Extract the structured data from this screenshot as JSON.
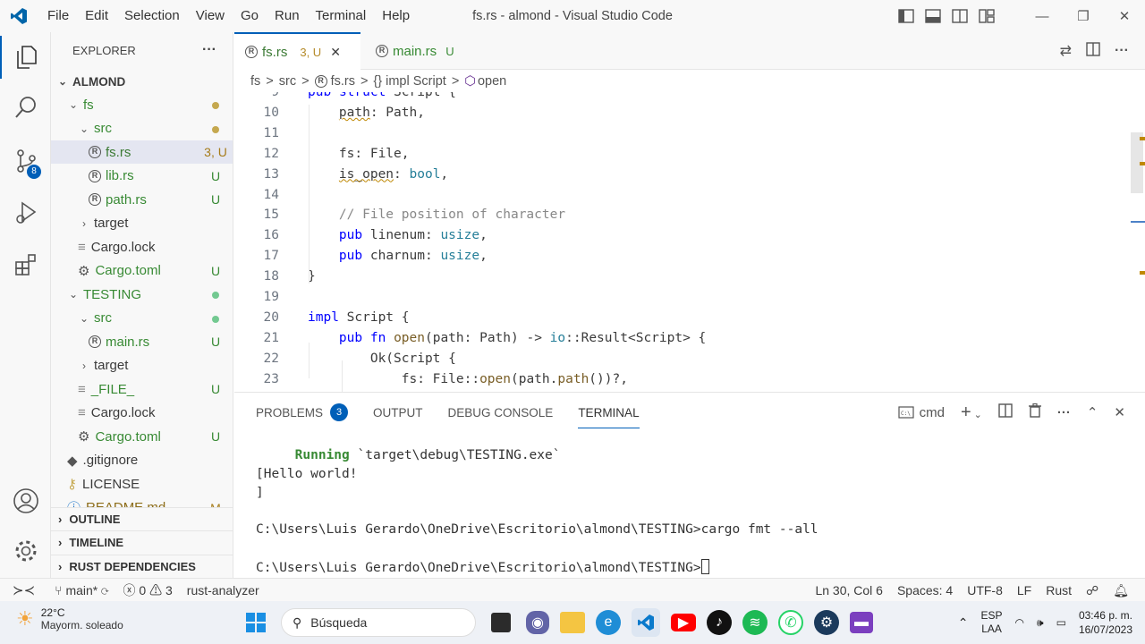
{
  "titlebar": {
    "menus": [
      "File",
      "Edit",
      "Selection",
      "View",
      "Go",
      "Run",
      "Terminal",
      "Help"
    ],
    "title": "fs.rs - almond - Visual Studio Code",
    "controls": {
      "minimize": "—",
      "restore": "❐",
      "close": "✕"
    }
  },
  "activity_bar": {
    "items": [
      "files-icon",
      "search-icon",
      "source-control-icon",
      "run-debug-icon",
      "extensions-icon"
    ],
    "scm_badge": "8",
    "bottom": [
      "account-icon",
      "settings-gear-icon"
    ]
  },
  "explorer": {
    "header": "EXPLORER",
    "more": "···",
    "root": "ALMOND",
    "rows": [
      {
        "label": "fs",
        "status": "",
        "dot": "#c5a84f",
        "kind": "folder",
        "indent": 1,
        "open": true
      },
      {
        "label": "src",
        "status": "",
        "dot": "#c5a84f",
        "kind": "folder",
        "indent": 2,
        "open": true
      },
      {
        "label": "fs.rs",
        "status": "3, U",
        "kind": "rust",
        "indent": 3
      },
      {
        "label": "lib.rs",
        "status": "U",
        "kind": "rust",
        "indent": 3
      },
      {
        "label": "path.rs",
        "status": "U",
        "kind": "rust",
        "indent": 3
      },
      {
        "label": "target",
        "status": "",
        "kind": "folder",
        "indent": 2,
        "open": false
      },
      {
        "label": "Cargo.lock",
        "status": "",
        "kind": "file",
        "indent": 2
      },
      {
        "label": "Cargo.toml",
        "status": "U",
        "kind": "gear",
        "indent": 2
      },
      {
        "label": "TESTING",
        "status": "",
        "dot": "#73c991",
        "kind": "folder",
        "indent": 1,
        "open": true
      },
      {
        "label": "src",
        "status": "",
        "dot": "#73c991",
        "kind": "folder",
        "indent": 2,
        "open": true
      },
      {
        "label": "main.rs",
        "status": "U",
        "kind": "rust",
        "indent": 3
      },
      {
        "label": "target",
        "status": "",
        "kind": "folder",
        "indent": 2,
        "open": false
      },
      {
        "label": "_FILE_",
        "status": "U",
        "kind": "file",
        "indent": 2
      },
      {
        "label": "Cargo.lock",
        "status": "",
        "kind": "file",
        "indent": 2
      },
      {
        "label": "Cargo.toml",
        "status": "U",
        "kind": "gear",
        "indent": 2
      },
      {
        "label": ".gitignore",
        "status": "",
        "kind": "git",
        "indent": 1
      },
      {
        "label": "LICENSE",
        "status": "",
        "kind": "license",
        "indent": 1
      },
      {
        "label": "README.md",
        "status": "M",
        "kind": "info",
        "indent": 1
      }
    ],
    "sections": [
      "OUTLINE",
      "TIMELINE",
      "RUST DEPENDENCIES"
    ]
  },
  "tabs": [
    {
      "label": "fs.rs",
      "status": "3, U",
      "close": "✕"
    },
    {
      "label": "main.rs",
      "status": "U"
    }
  ],
  "breadcrumb": [
    "fs",
    ">",
    "src",
    ">",
    "fs.rs",
    ">",
    "{} impl Script",
    ">",
    "open"
  ],
  "editor": {
    "lines": [
      {
        "n": "9",
        "t": "pub struct Script {"
      },
      {
        "n": "10",
        "t": "    path: Path,"
      },
      {
        "n": "11",
        "t": ""
      },
      {
        "n": "12",
        "t": "    fs: File,"
      },
      {
        "n": "13",
        "t": "    is_open: bool,"
      },
      {
        "n": "14",
        "t": ""
      },
      {
        "n": "15",
        "t": "    // File position of character"
      },
      {
        "n": "16",
        "t": "    pub linenum: usize,"
      },
      {
        "n": "17",
        "t": "    pub charnum: usize,"
      },
      {
        "n": "18",
        "t": "}"
      },
      {
        "n": "19",
        "t": ""
      },
      {
        "n": "20",
        "t": "impl Script {"
      },
      {
        "n": "21",
        "t": "    pub fn open(path: Path) -> io::Result<Script> {"
      },
      {
        "n": "22",
        "t": "        Ok(Script {"
      },
      {
        "n": "23",
        "t": "            fs: File::open(path.path())?,"
      }
    ]
  },
  "panel": {
    "tabs": [
      "PROBLEMS",
      "OUTPUT",
      "DEBUG CONSOLE",
      "TERMINAL"
    ],
    "problems_count": "3",
    "shell": "cmd",
    "terminal": {
      "running_label": "Running",
      "running_target": " `target\\debug\\TESTING.exe`",
      "lines": [
        "[Hello world!",
        "]",
        "",
        "C:\\Users\\Luis Gerardo\\OneDrive\\Escritorio\\almond\\TESTING>cargo fmt --all",
        "",
        "C:\\Users\\Luis Gerardo\\OneDrive\\Escritorio\\almond\\TESTING>"
      ]
    }
  },
  "statusbar": {
    "branch": "main*",
    "errors": "0",
    "warnings": "3",
    "analyzer": "rust-analyzer",
    "position": "Ln 30, Col 6",
    "spaces": "Spaces: 4",
    "encoding": "UTF-8",
    "eol": "LF",
    "language": "Rust"
  },
  "taskbar": {
    "temp": "22°C",
    "weather": "Mayorm. soleado",
    "search": "Búsqueda",
    "lang1": "ESP",
    "lang2": "LAA",
    "time": "03:46 p. m.",
    "date": "16/07/2023"
  }
}
